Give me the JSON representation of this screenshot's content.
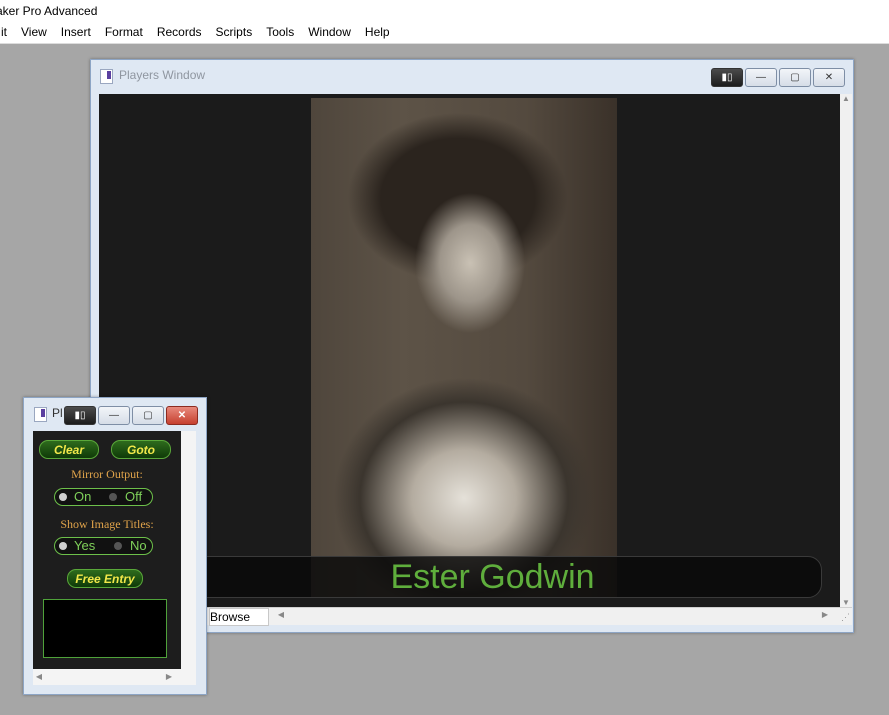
{
  "app": {
    "title": "aker Pro Advanced"
  },
  "menu": [
    "it",
    "View",
    "Insert",
    "Format",
    "Records",
    "Scripts",
    "Tools",
    "Window",
    "Help"
  ],
  "players_window": {
    "title": "Players Window",
    "image_title": "Ester Godwin",
    "mode": "Browse",
    "buttons": {
      "restore_glyph": "▢",
      "minimize_glyph": "—",
      "close_glyph": "✕",
      "dark_glyph": "▮▯"
    }
  },
  "palette_window": {
    "title": "Pl",
    "clear_label": "Clear",
    "goto_label": "Goto",
    "mirror_label": "Mirror Output:",
    "mirror_on": "On",
    "mirror_off": "Off",
    "titles_label": "Show Image Titles:",
    "titles_yes": "Yes",
    "titles_no": "No",
    "free_entry_label": "Free Entry"
  },
  "colors": {
    "accent_green": "#5fae3c",
    "label_orange": "#e0a34a",
    "pill_text": "#f2e84a"
  }
}
